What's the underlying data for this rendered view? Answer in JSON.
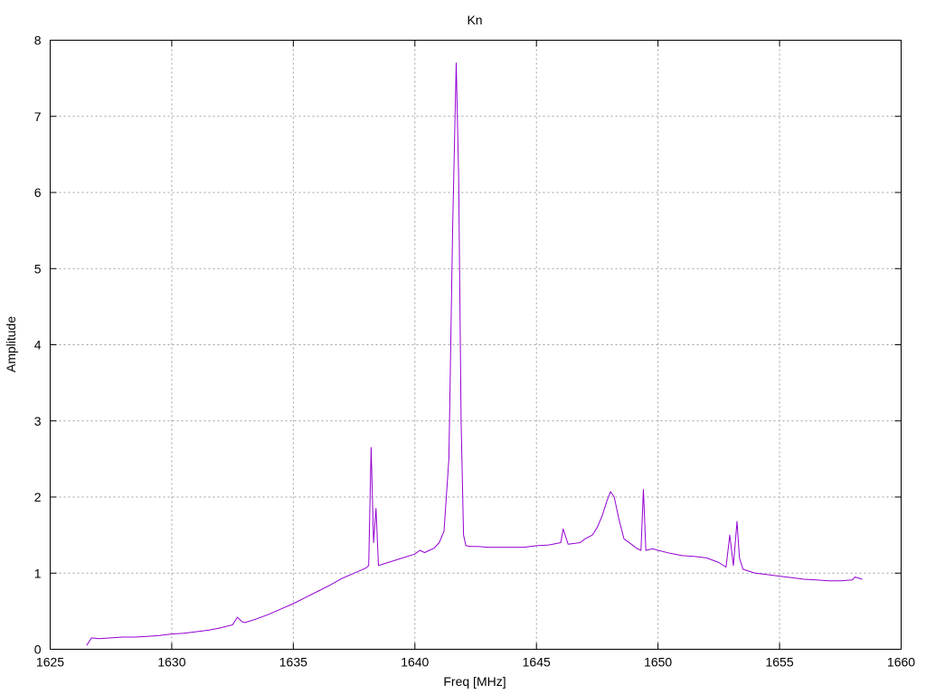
{
  "chart_data": {
    "type": "line",
    "title": "Kn",
    "xlabel": "Freq [MHz]",
    "ylabel": "Amplitude",
    "xlim": [
      1625,
      1660
    ],
    "ylim": [
      0,
      8
    ],
    "xticks": [
      1625,
      1630,
      1635,
      1640,
      1645,
      1650,
      1655,
      1660
    ],
    "yticks": [
      0,
      1,
      2,
      3,
      4,
      5,
      6,
      7,
      8
    ],
    "grid": true,
    "legend": "none",
    "series": [
      {
        "color": "#9400d3",
        "x": [
          1626.5,
          1626.7,
          1627.0,
          1627.5,
          1628.0,
          1628.5,
          1629.0,
          1629.5,
          1630.0,
          1630.5,
          1631.0,
          1631.5,
          1632.0,
          1632.5,
          1632.7,
          1632.9,
          1633.0,
          1633.5,
          1634.0,
          1634.5,
          1635.0,
          1635.5,
          1636.0,
          1636.5,
          1637.0,
          1637.5,
          1638.0,
          1638.1,
          1638.2,
          1638.3,
          1638.4,
          1638.5,
          1638.7,
          1639.0,
          1639.5,
          1640.0,
          1640.2,
          1640.4,
          1640.6,
          1640.8,
          1641.0,
          1641.2,
          1641.4,
          1641.55,
          1641.7,
          1641.8,
          1641.9,
          1642.0,
          1642.1,
          1642.3,
          1642.6,
          1643.0,
          1643.5,
          1644.0,
          1644.5,
          1645.0,
          1645.5,
          1646.0,
          1646.1,
          1646.3,
          1646.8,
          1647.0,
          1647.3,
          1647.5,
          1647.7,
          1647.9,
          1648.05,
          1648.2,
          1648.4,
          1648.6,
          1648.9,
          1649.1,
          1649.3,
          1649.4,
          1649.5,
          1649.8,
          1650.0,
          1650.5,
          1651.0,
          1651.5,
          1652.0,
          1652.5,
          1652.8,
          1652.95,
          1653.1,
          1653.25,
          1653.35,
          1653.5,
          1653.8,
          1654.0,
          1654.5,
          1655.0,
          1655.5,
          1656.0,
          1656.5,
          1657.0,
          1657.5,
          1658.0,
          1658.1,
          1658.4
        ],
        "y": [
          0.05,
          0.15,
          0.14,
          0.15,
          0.16,
          0.16,
          0.17,
          0.18,
          0.2,
          0.21,
          0.23,
          0.25,
          0.28,
          0.32,
          0.42,
          0.36,
          0.35,
          0.4,
          0.46,
          0.53,
          0.6,
          0.68,
          0.76,
          0.84,
          0.93,
          1.0,
          1.07,
          1.1,
          2.65,
          1.4,
          1.85,
          1.1,
          1.12,
          1.15,
          1.2,
          1.25,
          1.3,
          1.27,
          1.3,
          1.33,
          1.4,
          1.55,
          2.5,
          5.5,
          7.7,
          6.2,
          3.0,
          1.5,
          1.36,
          1.35,
          1.35,
          1.34,
          1.34,
          1.34,
          1.34,
          1.36,
          1.37,
          1.4,
          1.58,
          1.38,
          1.4,
          1.45,
          1.5,
          1.6,
          1.75,
          1.95,
          2.07,
          2.0,
          1.7,
          1.45,
          1.38,
          1.33,
          1.3,
          2.1,
          1.3,
          1.32,
          1.3,
          1.26,
          1.23,
          1.22,
          1.2,
          1.14,
          1.08,
          1.5,
          1.1,
          1.68,
          1.2,
          1.05,
          1.02,
          1.0,
          0.98,
          0.96,
          0.94,
          0.92,
          0.91,
          0.9,
          0.9,
          0.91,
          0.95,
          0.92
        ]
      }
    ]
  }
}
